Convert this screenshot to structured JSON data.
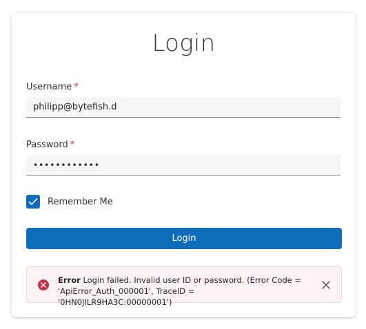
{
  "title": "Login",
  "username": {
    "label": "Username",
    "required_mark": "*",
    "value": "philipp@bytefish.d"
  },
  "password": {
    "label": "Password",
    "required_mark": "*",
    "masked_value": "••••••••••••"
  },
  "remember_me": {
    "label": "Remember Me",
    "checked": true
  },
  "login_button": {
    "label": "Login"
  },
  "error": {
    "heading": "Error",
    "message": "Login failed. Invalid user ID or password. (Error Code = 'ApiError_Auth_000001', TraceID = '0HN0JILR9HA3C:00000001')"
  },
  "icons": {
    "checkbox": "check-icon",
    "error": "error-circle-icon",
    "dismiss": "close-icon"
  },
  "colors": {
    "accent": "#0f6cbd",
    "error": "#c4314b",
    "error_background": "#fdf3f4"
  }
}
